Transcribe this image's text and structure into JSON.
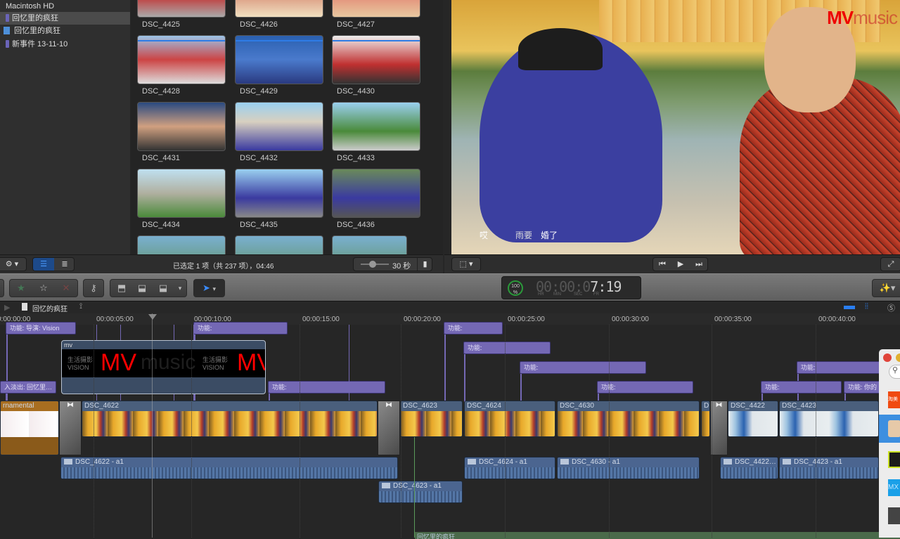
{
  "sidebar": {
    "items": [
      {
        "label": "Macintosh HD"
      },
      {
        "label": "回忆里的疯狂"
      },
      {
        "label": "回忆里的疯狂"
      },
      {
        "label": "新事件 13-11-10"
      }
    ]
  },
  "browser": {
    "clips": [
      "DSC_4425",
      "DSC_4426",
      "DSC_4427",
      "DSC_4428",
      "DSC_4429",
      "DSC_4430",
      "DSC_4431",
      "DSC_4432",
      "DSC_4433",
      "DSC_4434",
      "DSC_4435",
      "DSC_4436"
    ],
    "status": "已选定 1 项（共 237 项），04:46",
    "zoom_label": "30 秒"
  },
  "viewer": {
    "logo_mv": "MV",
    "logo_music": "music",
    "logo_cn": "生活摄影",
    "logo_vision": "VISION",
    "subtitles": [
      "哎",
      "雨要",
      "婚了"
    ]
  },
  "timecode": {
    "percent": "100",
    "percent_sign": "%",
    "dim": "00:00:0",
    "bright": "7:19",
    "units": [
      "HR",
      "MIN",
      "SEC",
      "FR"
    ]
  },
  "timeline": {
    "project": "回忆的疯狂",
    "ruler": [
      "0:00:00:00",
      "00:00:05:00",
      "00:00:10:00",
      "00:00:15:00",
      "00:00:20:00",
      "00:00:25:00",
      "00:00:30:00",
      "00:00:35:00",
      "00:00:40:00"
    ],
    "titles": [
      "功能: 导演: Vision",
      "功能:",
      "功能:",
      "功能:",
      "功能:",
      "功能:",
      "功能:",
      "功能:",
      "功能: 你的",
      "入淡出: 回忆里…",
      "功能:"
    ],
    "compound": {
      "name": "mv",
      "logo_cn": "生活摄影",
      "logo_vision": "VISION",
      "logo_mv": "MV",
      "logo_music": "music"
    },
    "clips": [
      "rnamental",
      "DSC_4622",
      "DSC_4623",
      "DSC_4624",
      "DSC_4630",
      "D.",
      "DSC_4422",
      "DSC_4423"
    ],
    "audio": [
      "DSC_4622 - a1",
      "DSC_4623 - a1",
      "DSC_4624 - a1",
      "DSC_4630 - a1",
      "DSC_4422…",
      "DSC_4423 - a1"
    ],
    "bottom_clip": "回忆里的疯狂"
  },
  "popup": {
    "icon_labels": [
      "淘美",
      "MX"
    ]
  }
}
